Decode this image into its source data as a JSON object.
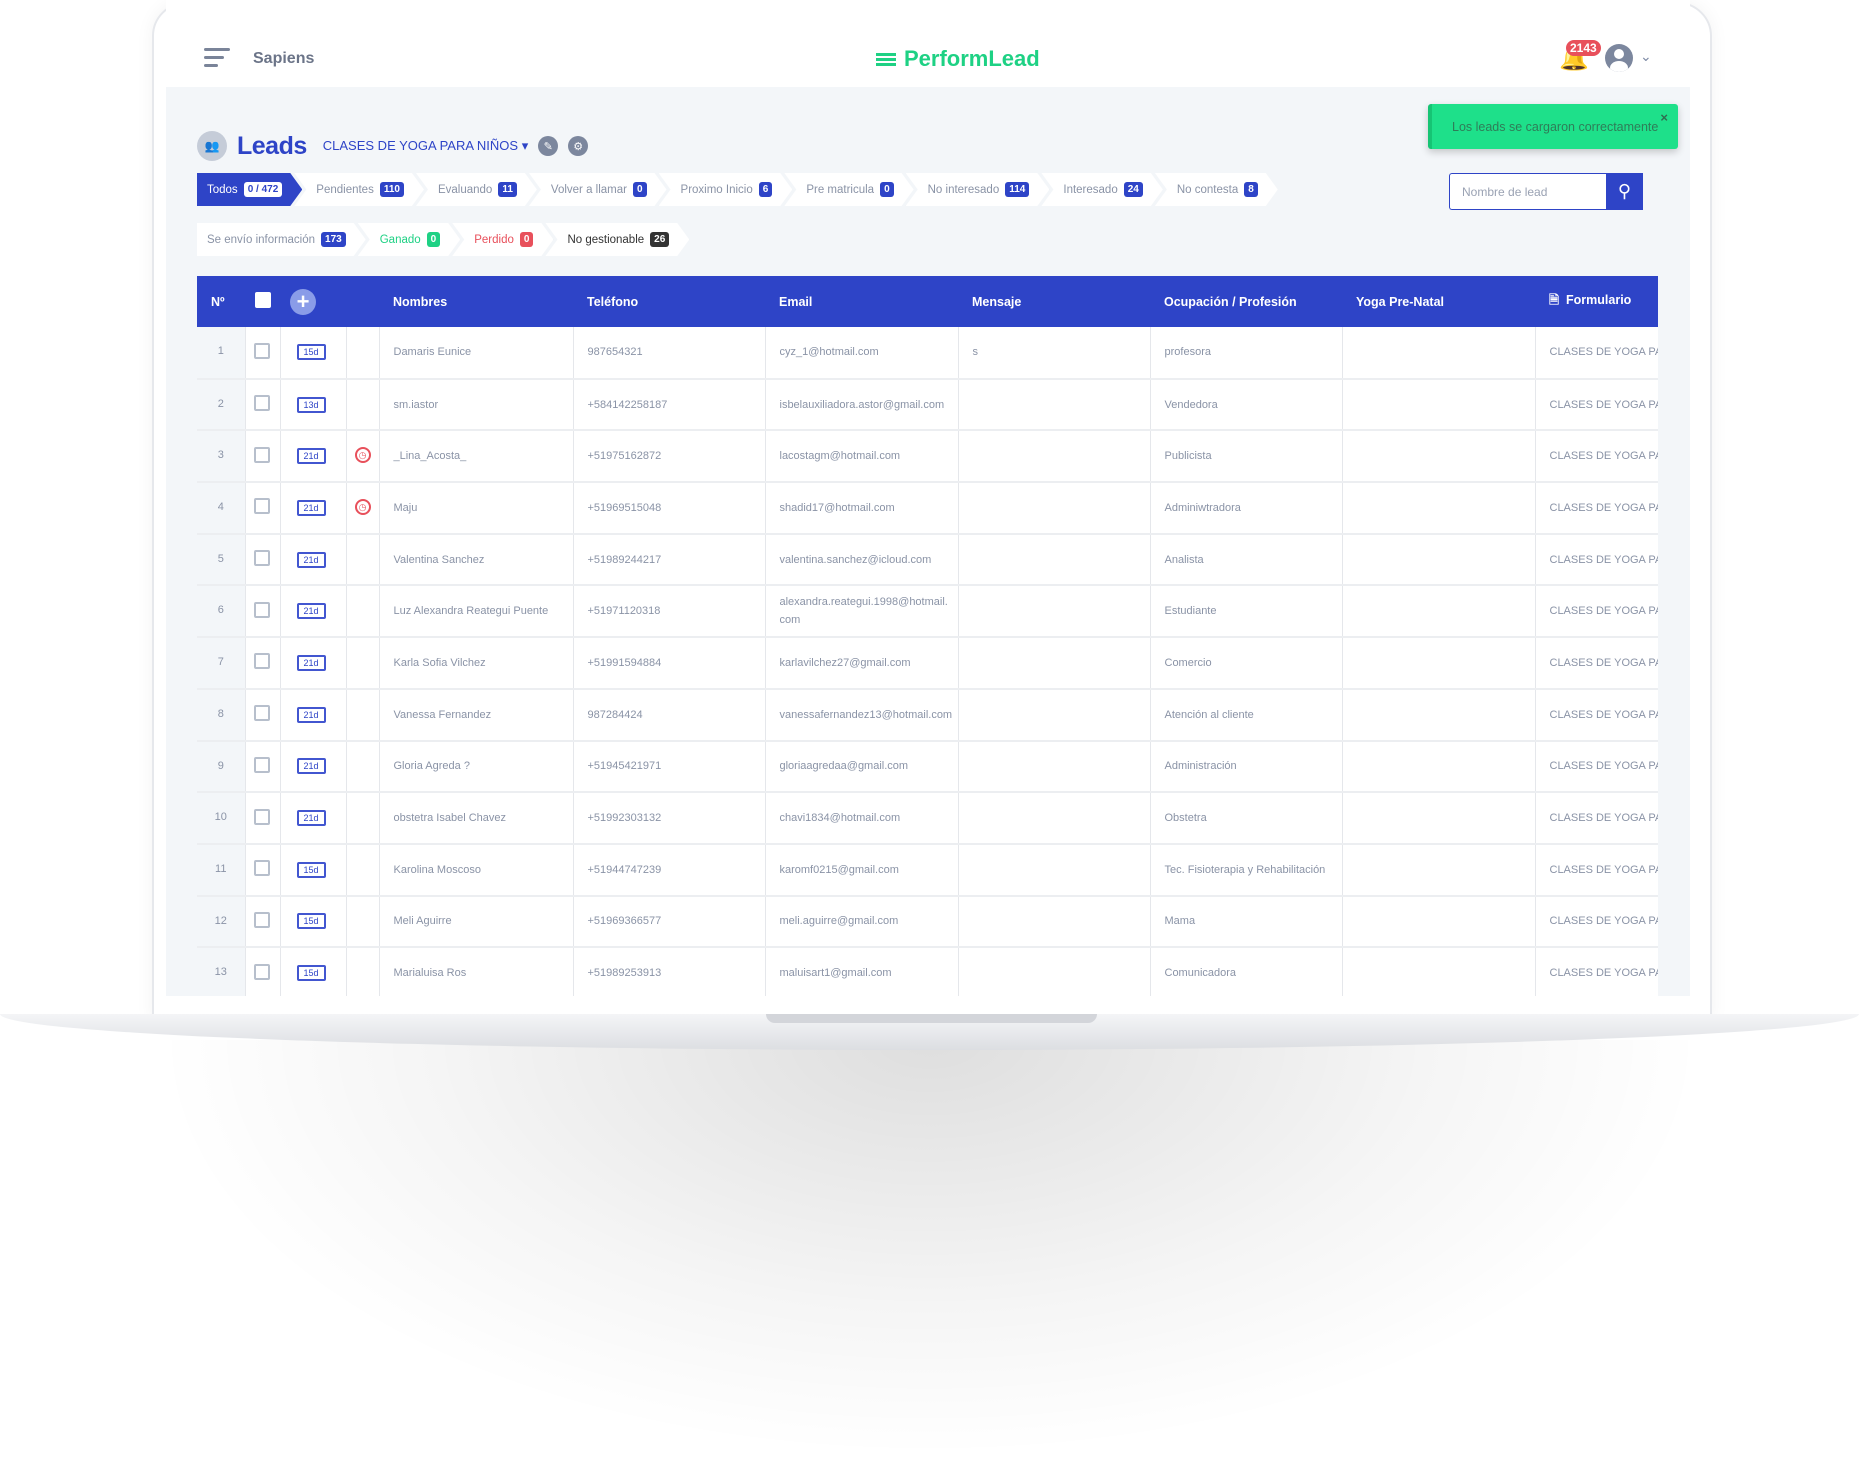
{
  "header": {
    "org": "Sapiens",
    "logo": "PerformLead",
    "notifications": "2143"
  },
  "page": {
    "title": "Leads",
    "campaign": "CLASES DE YOGA PARA NIÑOS"
  },
  "toast": {
    "message": "Los leads se cargaron correctamente",
    "close": "×"
  },
  "search": {
    "placeholder": "Nombre de lead"
  },
  "tabs_row1": [
    {
      "label": "Todos",
      "count": "0 / 472"
    },
    {
      "label": "Pendientes",
      "count": "110"
    },
    {
      "label": "Evaluando",
      "count": "11"
    },
    {
      "label": "Volver a llamar",
      "count": "0"
    },
    {
      "label": "Proximo Inicio",
      "count": "6"
    },
    {
      "label": "Pre matricula",
      "count": "0"
    },
    {
      "label": "No interesado",
      "count": "114"
    },
    {
      "label": "Interesado",
      "count": "24"
    },
    {
      "label": "No contesta",
      "count": "8"
    }
  ],
  "tabs_row2": [
    {
      "label": "Se envío información",
      "count": "173"
    },
    {
      "label": "Ganado",
      "count": "0"
    },
    {
      "label": "Perdido",
      "count": "0"
    },
    {
      "label": "No gestionable",
      "count": "26"
    }
  ],
  "colors": {
    "primary": "#2e44c7",
    "success": "#1ed184",
    "danger": "#e8505b"
  },
  "table": {
    "columns": [
      "Nº",
      "Nombres",
      "Teléfono",
      "Email",
      "Mensaje",
      "Ocupación / Profesión",
      "Yoga Pre-Natal",
      "Formulario"
    ],
    "rows": [
      {
        "n": "1",
        "days": "15d",
        "alert": false,
        "name": "Damaris Eunice",
        "phone": "987654321",
        "email": "cyz_1@hotmail.com",
        "msg": "s",
        "job": "profesora",
        "prenatal": "",
        "form": "CLASES DE YOGA PARA"
      },
      {
        "n": "2",
        "days": "13d",
        "alert": false,
        "name": "sm.iastor",
        "phone": "+584142258187",
        "email": "isbelauxiliadora.astor@gmail.com",
        "msg": "",
        "job": "Vendedora",
        "prenatal": "",
        "form": "CLASES DE YOGA PARA"
      },
      {
        "n": "3",
        "days": "21d",
        "alert": true,
        "name": "_Lina_Acosta_",
        "phone": "+51975162872",
        "email": "lacostagm@hotmail.com",
        "msg": "",
        "job": "Publicista",
        "prenatal": "",
        "form": "CLASES DE YOGA PARA"
      },
      {
        "n": "4",
        "days": "21d",
        "alert": true,
        "name": "Maju",
        "phone": "+51969515048",
        "email": "shadid17@hotmail.com",
        "msg": "",
        "job": "Adminiwtradora",
        "prenatal": "",
        "form": "CLASES DE YOGA PARA"
      },
      {
        "n": "5",
        "days": "21d",
        "alert": false,
        "name": "Valentina Sanchez",
        "phone": "+51989244217",
        "email": "valentina.sanchez@icloud.com",
        "msg": "",
        "job": "Analista",
        "prenatal": "",
        "form": "CLASES DE YOGA PARA"
      },
      {
        "n": "6",
        "days": "21d",
        "alert": false,
        "name": "Luz Alexandra Reategui Puente",
        "phone": "+51971120318",
        "email": "alexandra.reategui.1998@hotmail.com",
        "msg": "",
        "job": "Estudiante",
        "prenatal": "",
        "form": "CLASES DE YOGA PARA"
      },
      {
        "n": "7",
        "days": "21d",
        "alert": false,
        "name": "Karla Sofia Vilchez",
        "phone": "+51991594884",
        "email": "karlavilchez27@gmail.com",
        "msg": "",
        "job": "Comercio",
        "prenatal": "",
        "form": "CLASES DE YOGA PARA"
      },
      {
        "n": "8",
        "days": "21d",
        "alert": false,
        "name": "Vanessa Fernandez",
        "phone": "987284424",
        "email": "vanessafernandez13@hotmail.com",
        "msg": "",
        "job": "Atención al cliente",
        "prenatal": "",
        "form": "CLASES DE YOGA PARA"
      },
      {
        "n": "9",
        "days": "21d",
        "alert": false,
        "name": "Gloria Agreda ?",
        "phone": "+51945421971",
        "email": "gloriaagredaa@gmail.com",
        "msg": "",
        "job": "Administración",
        "prenatal": "",
        "form": "CLASES DE YOGA PARA"
      },
      {
        "n": "10",
        "days": "21d",
        "alert": false,
        "name": "obstetra Isabel Chavez",
        "phone": "+51992303132",
        "email": "chavi1834@hotmail.com",
        "msg": "",
        "job": "Obstetra",
        "prenatal": "",
        "form": "CLASES DE YOGA PARA"
      },
      {
        "n": "11",
        "days": "15d",
        "alert": false,
        "name": "Karolina Moscoso",
        "phone": "+51944747239",
        "email": "karomf0215@gmail.com",
        "msg": "",
        "job": "Tec. Fisioterapia y Rehabilitación",
        "prenatal": "",
        "form": "CLASES DE YOGA PARA"
      },
      {
        "n": "12",
        "days": "15d",
        "alert": false,
        "name": "Meli Aguirre",
        "phone": "+51969366577",
        "email": "meli.aguirre@gmail.com",
        "msg": "",
        "job": "Mama",
        "prenatal": "",
        "form": "CLASES DE YOGA PARA"
      },
      {
        "n": "13",
        "days": "15d",
        "alert": false,
        "name": "Marialuisa Ros",
        "phone": "+51989253913",
        "email": "maluisart1@gmail.com",
        "msg": "",
        "job": "Comunicadora",
        "prenatal": "",
        "form": "CLASES DE YOGA PARA"
      }
    ]
  }
}
